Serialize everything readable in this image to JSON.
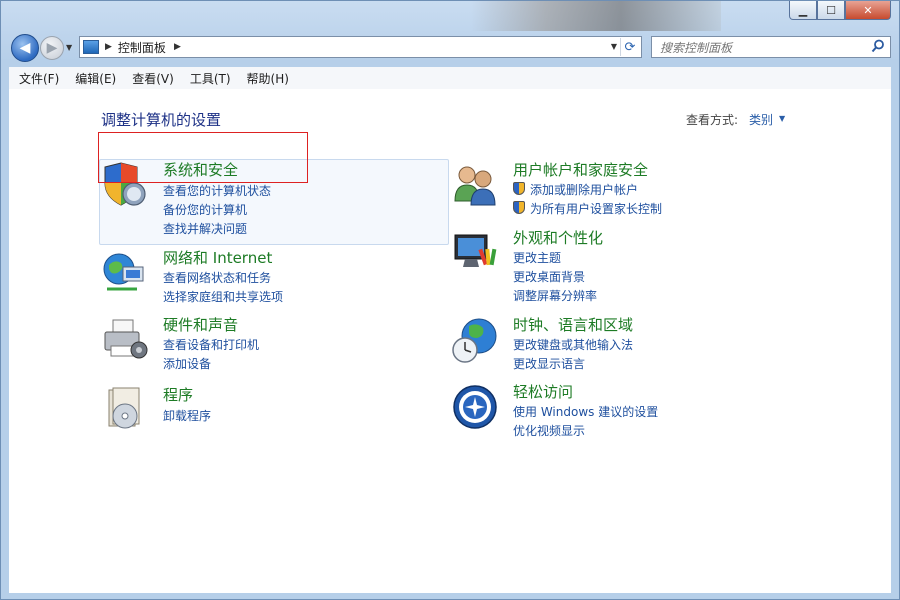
{
  "window": {
    "controls": {
      "minimize": "▁",
      "maximize": "☐",
      "close": "✕"
    }
  },
  "nav": {
    "back_glyph": "◀",
    "forward_glyph": "▶",
    "dropdown_glyph": "▼",
    "breadcrumb": "控制面板",
    "breadcrumb_sep": "▶",
    "refresh_glyph": "⟳"
  },
  "search": {
    "placeholder": "搜索控制面板"
  },
  "menu": [
    "文件(F)",
    "编辑(E)",
    "查看(V)",
    "工具(T)",
    "帮助(H)"
  ],
  "page": {
    "heading": "调整计算机的设置",
    "view_by_label": "查看方式:",
    "view_by_value": "类别",
    "view_by_arrow": "▼"
  },
  "categories": [
    {
      "title": "系统和安全",
      "icon": "shield-security-icon",
      "links": [
        "查看您的计算机状态",
        "备份您的计算机",
        "查找并解决问题"
      ]
    },
    {
      "title": "网络和 Internet",
      "icon": "network-globe-icon",
      "links": [
        "查看网络状态和任务",
        "选择家庭组和共享选项"
      ]
    },
    {
      "title": "硬件和声音",
      "icon": "printer-hardware-icon",
      "links": [
        "查看设备和打印机",
        "添加设备"
      ]
    },
    {
      "title": "程序",
      "icon": "programs-disc-icon",
      "links": [
        "卸载程序"
      ]
    },
    {
      "title": "用户帐户和家庭安全",
      "icon": "users-icon",
      "links": [
        "添加或删除用户帐户",
        "为所有用户设置家长控制"
      ]
    },
    {
      "title": "外观和个性化",
      "icon": "appearance-monitor-icon",
      "links": [
        "更改主题",
        "更改桌面背景",
        "调整屏幕分辨率"
      ]
    },
    {
      "title": "时钟、语言和区域",
      "icon": "clock-globe-icon",
      "links": [
        "更改键盘或其他输入法",
        "更改显示语言"
      ]
    },
    {
      "title": "轻松访问",
      "icon": "ease-of-access-icon",
      "links": [
        "使用 Windows 建议的设置",
        "优化视频显示"
      ]
    }
  ],
  "colors": {
    "category_title": "#1d7b25",
    "link": "#1e4f9e",
    "heading": "#1e3287",
    "highlight_border": "#d22222"
  }
}
